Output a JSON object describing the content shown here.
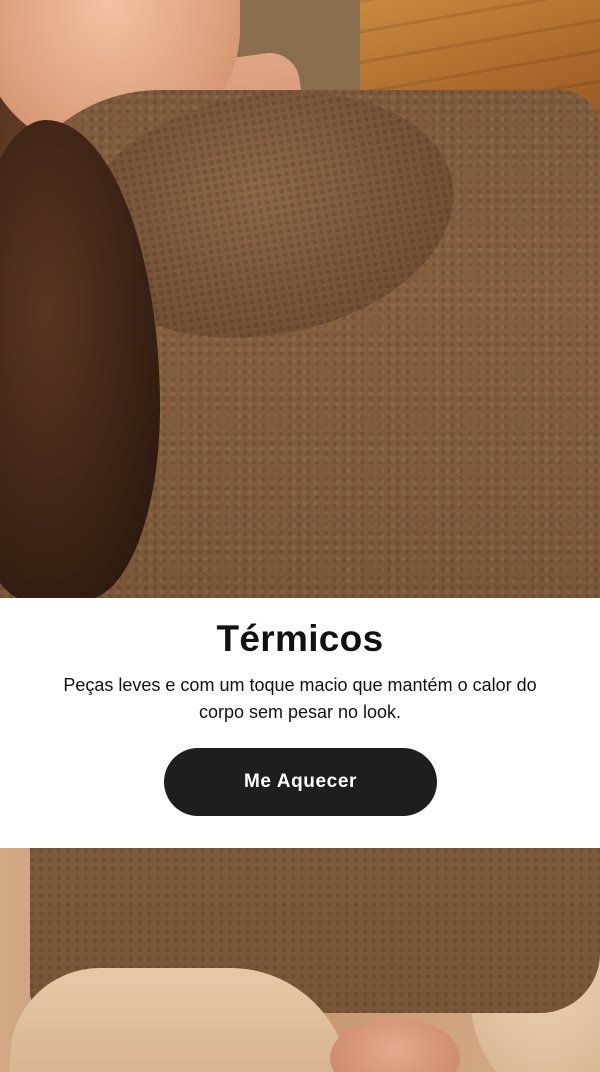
{
  "hero": {
    "top_image": "model-thermal-sweater-closeup",
    "bottom_image": "model-thermal-sweater-seated"
  },
  "promo": {
    "title": "Térmicos",
    "description": "Peças leves e com um toque macio que mantém o calor do corpo sem pesar no look.",
    "cta_label": "Me Aquecer"
  },
  "colors": {
    "panel_bg": "#ffffff",
    "text": "#111111",
    "button_bg": "#1e1e1e",
    "button_text": "#ffffff",
    "sweater": "#7e5a3c"
  }
}
